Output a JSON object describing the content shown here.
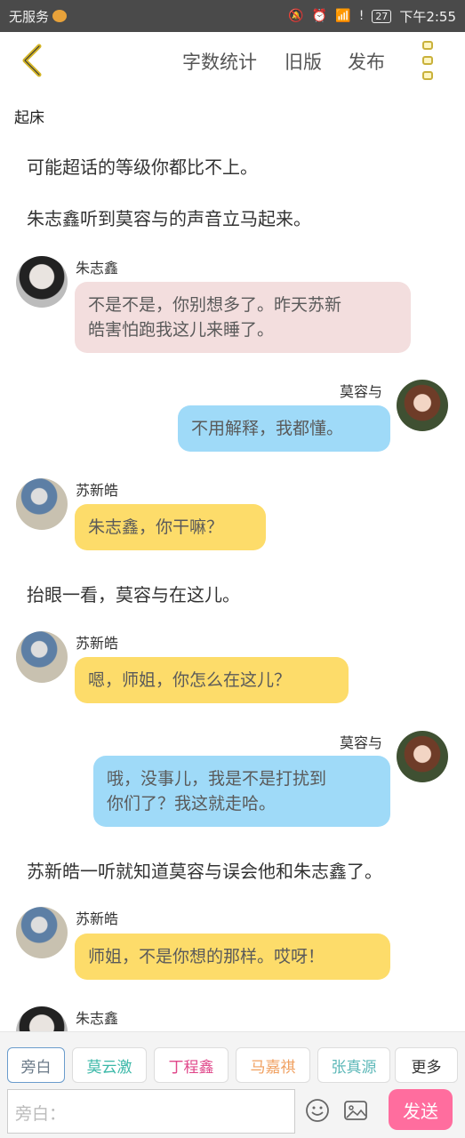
{
  "statusbar": {
    "carrier": "无服务",
    "battery": "27",
    "time": "下午2:55"
  },
  "header": {
    "word_count": "字数统计",
    "old_version": "旧版",
    "publish": "发布"
  },
  "chat": {
    "section_title": "起床",
    "narration_1": "可能超话的等级你都比不上。",
    "narration_2": "朱志鑫听到莫容与的声音立马起来。",
    "msg1": {
      "name": "朱志鑫",
      "text_1": "不是不是，你别想多了。昨天苏新",
      "text_2": "皓害怕跑我这儿来睡了。"
    },
    "msg2": {
      "name": "莫容与",
      "text": "不用解释，我都懂。"
    },
    "msg3": {
      "name": "苏新皓",
      "text": "朱志鑫，你干嘛？"
    },
    "narration_3": "抬眼一看，莫容与在这儿。",
    "msg4": {
      "name": "苏新皓",
      "text": "嗯，师姐，你怎么在这儿？"
    },
    "msg5": {
      "name": "莫容与",
      "text_1": "哦，没事儿，我是不是打扰到",
      "text_2": "你们了？我这就走哈。"
    },
    "narration_4": "苏新皓一听就知道莫容与误会他和朱志鑫了。",
    "msg6": {
      "name": "苏新皓",
      "text": "师姐，不是你想的那样。哎呀！"
    },
    "msg7": {
      "name": "朱志鑫"
    }
  },
  "roles": [
    {
      "label": "旁白",
      "color": "#6b7a88"
    },
    {
      "label": "莫云激",
      "color": "#3bb8a8"
    },
    {
      "label": "丁程鑫",
      "color": "#e0478a"
    },
    {
      "label": "马嘉祺",
      "color": "#f0a060"
    },
    {
      "label": "张真源",
      "color": "#5db8b8"
    },
    {
      "label": "更多",
      "color": "#333333"
    }
  ],
  "input": {
    "placeholder": "旁白：",
    "send_label": "发送"
  }
}
